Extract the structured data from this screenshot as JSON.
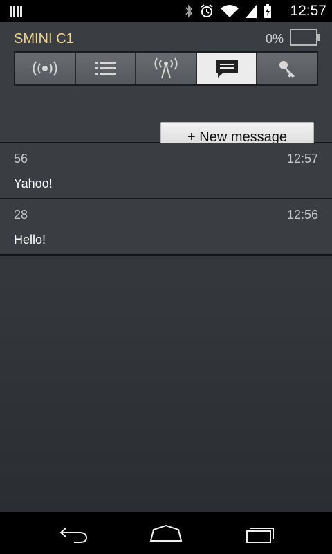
{
  "status_bar": {
    "time": "12:57",
    "icons": [
      "notification-icon",
      "bluetooth-icon",
      "alarm-icon",
      "wifi-icon",
      "signal-icon",
      "battery-charging-icon"
    ]
  },
  "app": {
    "title": "SMINI C1",
    "battery_percent": "0%"
  },
  "tabs": [
    {
      "icon": "signal-broadcast-icon",
      "active": false
    },
    {
      "icon": "list-icon",
      "active": false
    },
    {
      "icon": "antenna-icon",
      "active": false
    },
    {
      "icon": "message-icon",
      "active": true
    },
    {
      "icon": "key-icon",
      "active": false
    }
  ],
  "actions": {
    "new_message": "+ New message"
  },
  "messages": [
    {
      "id": "56",
      "time": "12:57",
      "text": "Yahoo!"
    },
    {
      "id": "28",
      "time": "12:56",
      "text": "Hello!"
    }
  ],
  "navigation": {
    "back": "back-icon",
    "home": "home-icon",
    "recent": "recent-apps-icon"
  }
}
